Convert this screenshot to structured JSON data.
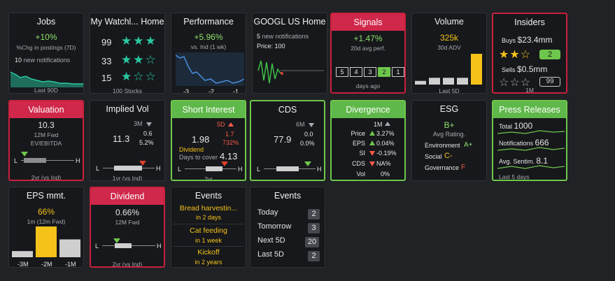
{
  "jobs": {
    "title": "Jobs",
    "change": "+10%",
    "subtitle": "%Chg in postings (7D)",
    "notif_count": "10",
    "notif_label": "new notifications",
    "footer": "Last 90D"
  },
  "watchlist": {
    "title": "My Watchl... Home",
    "rows": [
      {
        "value": "99",
        "stars": "★★★"
      },
      {
        "value": "33",
        "stars": "★★☆"
      },
      {
        "value": "15",
        "stars": "★☆☆"
      }
    ],
    "footer": "100 Stocks"
  },
  "performance": {
    "title": "Performance",
    "change": "+5.96%",
    "subtitle": "vs. Ind (1 wk)",
    "ticks": [
      "-3",
      "-2",
      "-1"
    ]
  },
  "googl": {
    "title": "GOOGL US Home",
    "notif_count": "5",
    "notif_label": "new notifications",
    "price": "Price: 100"
  },
  "signals": {
    "title": "Signals",
    "change": "+1.47%",
    "subtitle": "20d avg perf.",
    "boxes": [
      "5",
      "4",
      "3",
      "2",
      "1"
    ],
    "active_box": "2",
    "footer": "days ago"
  },
  "volume": {
    "title": "Volume",
    "value": "325k",
    "subtitle": "30d ADV",
    "footer": "Last 5D",
    "bars": [
      0.12,
      0.22,
      0.22,
      0.22,
      1.0
    ]
  },
  "insiders": {
    "title": "Insiders",
    "buys_label": "Buys",
    "buys_value": "$23.4mm",
    "buy_stars": "★★☆",
    "buy_badge": "2",
    "sells_label": "Sells",
    "sells_value": "$0.5mm",
    "sell_stars": "☆☆☆",
    "sell_badge": "99",
    "footer": "1M"
  },
  "valuation": {
    "title": "Valuation",
    "value": "10.3",
    "sub1": "12M Fwd",
    "sub2": "EV/EBITDA",
    "low": "L",
    "high": "H",
    "footer": "2yr (vs Ind)"
  },
  "implied_vol": {
    "title": "Implied Vol",
    "period": "3M",
    "v1": "0.6",
    "main": "11.3",
    "v2": "5.2%",
    "low": "L",
    "high": "H",
    "footer": "1yr (vs Ind)"
  },
  "short_interest": {
    "title": "Short Interest",
    "period": "5D",
    "main": "1.98",
    "v1": "1.7",
    "v2": "732%",
    "dtc_label1": "Dividend",
    "dtc_label2": "Days to cover",
    "dtc_value": "4.13",
    "low": "L",
    "high": "H",
    "footer": "2yr"
  },
  "cds": {
    "title": "CDS",
    "period": "6M",
    "main": "77.9",
    "v1": "0.0",
    "v2": "0.0%",
    "low": "L",
    "high": "H"
  },
  "divergence": {
    "title": "Divergence",
    "period": "1M",
    "rows": [
      {
        "label": "Price",
        "dir": "up",
        "value": "3.27%"
      },
      {
        "label": "EPS",
        "dir": "up",
        "value": "0.04%"
      },
      {
        "label": "SI",
        "dir": "down",
        "value": "-0.19%"
      },
      {
        "label": "CDS",
        "dir": "down",
        "value": "NA%"
      },
      {
        "label": "Vol",
        "dir": "none",
        "value": "0%"
      }
    ]
  },
  "esg": {
    "title": "ESG",
    "grade": "B+",
    "subtitle": "Avg Rating.",
    "rows": [
      {
        "label": "Environment",
        "grade": "A+"
      },
      {
        "label": "Social",
        "grade": "C-"
      },
      {
        "label": "Governance",
        "grade": "F"
      }
    ]
  },
  "press": {
    "title": "Press Releases",
    "rows": [
      {
        "label": "Total",
        "value": "1000"
      },
      {
        "label": "Notifications",
        "value": "666"
      },
      {
        "label": "Avg. Sentim.",
        "value": "8.1"
      }
    ],
    "footer": "Last 5 days"
  },
  "eps": {
    "title": "EPS mmt.",
    "change": "66%",
    "subtitle": "1m (12m Fwd)",
    "ticks": [
      "-3M",
      "-2M",
      "-1M"
    ],
    "bars": [
      0.2,
      1.0,
      0.58
    ]
  },
  "dividend": {
    "title": "Dividend",
    "value": "0.66%",
    "subtitle": "12M Fwd",
    "low": "L",
    "high": "H",
    "footer": "2yr (vs Ind)"
  },
  "events1": {
    "title": "Events",
    "items": [
      {
        "name": "Bread harvestin...",
        "when": "in 2 days"
      },
      {
        "name": "Cat feeding",
        "when": "in 1 week"
      },
      {
        "name": "Kickoff",
        "when": "in 2 years"
      }
    ]
  },
  "events2": {
    "title": "Events",
    "rows": [
      {
        "label": "Today",
        "count": "2"
      },
      {
        "label": "Tomorrow",
        "count": "3"
      },
      {
        "label": "Next 5D",
        "count": "20"
      },
      {
        "label": "Last 5D",
        "count": "2"
      }
    ]
  },
  "colors": {
    "red": "#d0284a",
    "green": "#5fb84a",
    "teal": "#29c9a0",
    "yellow": "#f5c21a"
  }
}
